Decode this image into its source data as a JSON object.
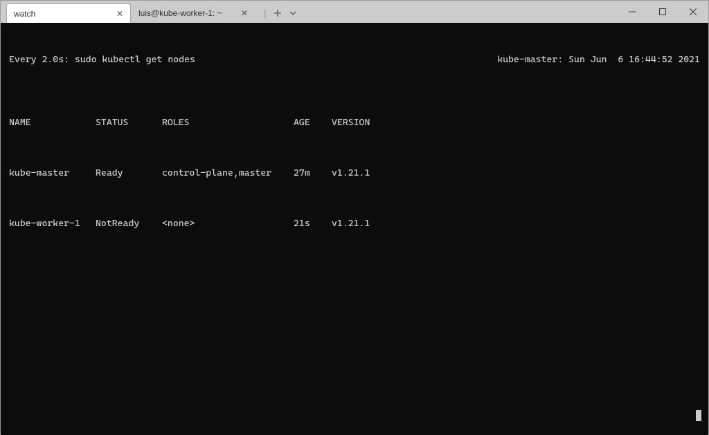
{
  "tabs": [
    {
      "title": "watch",
      "active": true
    },
    {
      "title": "luis@kube-worker-1: ~",
      "active": false
    }
  ],
  "watch": {
    "cmd": "Every 2.0s: sudo kubectl get nodes",
    "info": "kube-master: Sun Jun  6 16:44:52 2021"
  },
  "headers": {
    "name": "NAME",
    "status": "STATUS",
    "roles": "ROLES",
    "age": "AGE",
    "version": "VERSION"
  },
  "rows": [
    {
      "name": "kube-master",
      "status": "Ready",
      "roles": "control-plane,master",
      "age": "27m",
      "version": "v1.21.1"
    },
    {
      "name": "kube-worker-1",
      "status": "NotReady",
      "roles": "<none>",
      "age": "21s",
      "version": "v1.21.1"
    }
  ]
}
